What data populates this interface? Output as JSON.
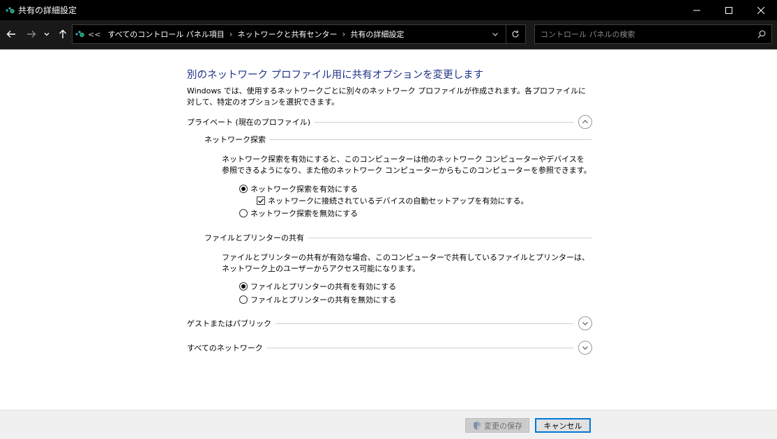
{
  "window": {
    "title": "共有の詳細設定"
  },
  "nav": {
    "breadcrumbs": [
      "すべてのコントロール パネル項目",
      "ネットワークと共有センター",
      "共有の詳細設定"
    ],
    "overflow": "<<",
    "separator": "›",
    "search_placeholder": "コントロール パネルの検索"
  },
  "main": {
    "heading": "別のネットワーク プロファイル用に共有オプションを変更します",
    "intro": "Windows では、使用するネットワークごとに別々のネットワーク プロファイルが作成されます。各プロファイルに対して、特定のオプションを選択できます。",
    "profiles": {
      "private": {
        "label": "プライベート (現在のプロファイル)",
        "expanded": true,
        "network_discovery": {
          "title": "ネットワーク探索",
          "description": "ネットワーク探索を有効にすると、このコンピューターは他のネットワーク コンピューターやデバイスを参照できるようになり、また他のネットワーク コンピューターからもこのコンピューターを参照できます。",
          "options": {
            "enable": "ネットワーク探索を有効にする",
            "auto_setup": "ネットワークに接続されているデバイスの自動セットアップを有効にする。",
            "disable": "ネットワーク探索を無効にする"
          },
          "selected": "enable",
          "auto_setup_checked": true
        },
        "file_printer": {
          "title": "ファイルとプリンターの共有",
          "description": "ファイルとプリンターの共有が有効な場合、このコンピューターで共有しているファイルとプリンターは、ネットワーク上のユーザーからアクセス可能になります。",
          "options": {
            "enable": "ファイルとプリンターの共有を有効にする",
            "disable": "ファイルとプリンターの共有を無効にする"
          },
          "selected": "enable"
        }
      },
      "guest_public": {
        "label": "ゲストまたはパブリック",
        "expanded": false
      },
      "all_networks": {
        "label": "すべてのネットワーク",
        "expanded": false
      }
    }
  },
  "footer": {
    "save_label": "変更の保存",
    "cancel_label": "キャンセル"
  },
  "colors": {
    "heading": "#1e3287",
    "titlebar": "#000000",
    "navbar": "#191919",
    "focus": "#0078d7"
  }
}
